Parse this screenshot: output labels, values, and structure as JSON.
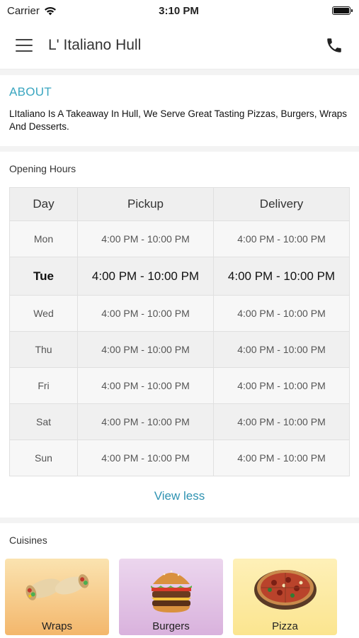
{
  "status_bar": {
    "carrier": "Carrier",
    "time": "3:10 PM"
  },
  "nav": {
    "title": "L' Italiano Hull"
  },
  "about": {
    "title": "ABOUT",
    "text": "LItaliano Is A Takeaway In Hull, We Serve Great Tasting Pizzas, Burgers, Wraps And Desserts."
  },
  "opening_hours": {
    "label": "Opening Hours",
    "headers": [
      "Day",
      "Pickup",
      "Delivery"
    ],
    "rows": [
      {
        "day": "Mon",
        "pickup": "4:00 PM - 10:00 PM",
        "delivery": "4:00 PM - 10:00 PM"
      },
      {
        "day": "Tue",
        "pickup": "4:00 PM - 10:00 PM",
        "delivery": "4:00 PM - 10:00 PM"
      },
      {
        "day": "Wed",
        "pickup": "4:00 PM - 10:00 PM",
        "delivery": "4:00 PM - 10:00 PM"
      },
      {
        "day": "Thu",
        "pickup": "4:00 PM - 10:00 PM",
        "delivery": "4:00 PM - 10:00 PM"
      },
      {
        "day": "Fri",
        "pickup": "4:00 PM - 10:00 PM",
        "delivery": "4:00 PM - 10:00 PM"
      },
      {
        "day": "Sat",
        "pickup": "4:00 PM - 10:00 PM",
        "delivery": "4:00 PM - 10:00 PM"
      },
      {
        "day": "Sun",
        "pickup": "4:00 PM - 10:00 PM",
        "delivery": "4:00 PM - 10:00 PM"
      }
    ],
    "view_less": "View less"
  },
  "cuisines": {
    "label": "Cuisines",
    "items": [
      {
        "label": "Wraps",
        "icon": "wraps-image"
      },
      {
        "label": "Burgers",
        "icon": "burger-image"
      },
      {
        "label": "Pizza",
        "icon": "pizza-image"
      }
    ]
  },
  "colors": {
    "accent": "#3aa6c0",
    "link": "#2f93b2"
  }
}
